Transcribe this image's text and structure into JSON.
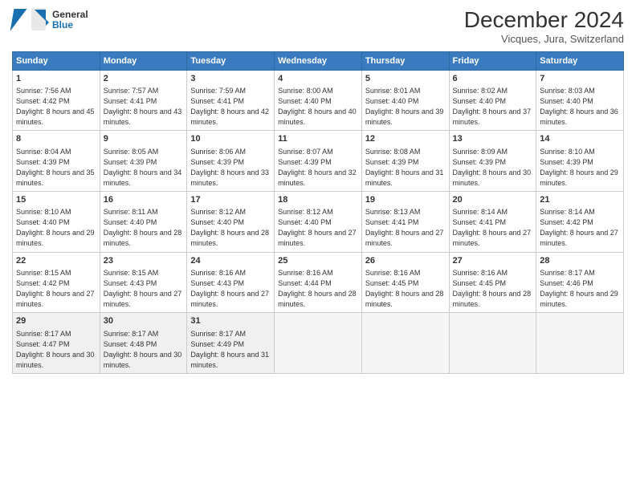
{
  "header": {
    "logo_line1": "General",
    "logo_line2": "Blue",
    "month_title": "December 2024",
    "location": "Vicques, Jura, Switzerland"
  },
  "days_of_week": [
    "Sunday",
    "Monday",
    "Tuesday",
    "Wednesday",
    "Thursday",
    "Friday",
    "Saturday"
  ],
  "weeks": [
    [
      {
        "day": "1",
        "sunrise": "7:56 AM",
        "sunset": "4:42 PM",
        "daylight": "8 hours and 45 minutes."
      },
      {
        "day": "2",
        "sunrise": "7:57 AM",
        "sunset": "4:41 PM",
        "daylight": "8 hours and 43 minutes."
      },
      {
        "day": "3",
        "sunrise": "7:59 AM",
        "sunset": "4:41 PM",
        "daylight": "8 hours and 42 minutes."
      },
      {
        "day": "4",
        "sunrise": "8:00 AM",
        "sunset": "4:40 PM",
        "daylight": "8 hours and 40 minutes."
      },
      {
        "day": "5",
        "sunrise": "8:01 AM",
        "sunset": "4:40 PM",
        "daylight": "8 hours and 39 minutes."
      },
      {
        "day": "6",
        "sunrise": "8:02 AM",
        "sunset": "4:40 PM",
        "daylight": "8 hours and 37 minutes."
      },
      {
        "day": "7",
        "sunrise": "8:03 AM",
        "sunset": "4:40 PM",
        "daylight": "8 hours and 36 minutes."
      }
    ],
    [
      {
        "day": "8",
        "sunrise": "8:04 AM",
        "sunset": "4:39 PM",
        "daylight": "8 hours and 35 minutes."
      },
      {
        "day": "9",
        "sunrise": "8:05 AM",
        "sunset": "4:39 PM",
        "daylight": "8 hours and 34 minutes."
      },
      {
        "day": "10",
        "sunrise": "8:06 AM",
        "sunset": "4:39 PM",
        "daylight": "8 hours and 33 minutes."
      },
      {
        "day": "11",
        "sunrise": "8:07 AM",
        "sunset": "4:39 PM",
        "daylight": "8 hours and 32 minutes."
      },
      {
        "day": "12",
        "sunrise": "8:08 AM",
        "sunset": "4:39 PM",
        "daylight": "8 hours and 31 minutes."
      },
      {
        "day": "13",
        "sunrise": "8:09 AM",
        "sunset": "4:39 PM",
        "daylight": "8 hours and 30 minutes."
      },
      {
        "day": "14",
        "sunrise": "8:10 AM",
        "sunset": "4:39 PM",
        "daylight": "8 hours and 29 minutes."
      }
    ],
    [
      {
        "day": "15",
        "sunrise": "8:10 AM",
        "sunset": "4:40 PM",
        "daylight": "8 hours and 29 minutes."
      },
      {
        "day": "16",
        "sunrise": "8:11 AM",
        "sunset": "4:40 PM",
        "daylight": "8 hours and 28 minutes."
      },
      {
        "day": "17",
        "sunrise": "8:12 AM",
        "sunset": "4:40 PM",
        "daylight": "8 hours and 28 minutes."
      },
      {
        "day": "18",
        "sunrise": "8:12 AM",
        "sunset": "4:40 PM",
        "daylight": "8 hours and 27 minutes."
      },
      {
        "day": "19",
        "sunrise": "8:13 AM",
        "sunset": "4:41 PM",
        "daylight": "8 hours and 27 minutes."
      },
      {
        "day": "20",
        "sunrise": "8:14 AM",
        "sunset": "4:41 PM",
        "daylight": "8 hours and 27 minutes."
      },
      {
        "day": "21",
        "sunrise": "8:14 AM",
        "sunset": "4:42 PM",
        "daylight": "8 hours and 27 minutes."
      }
    ],
    [
      {
        "day": "22",
        "sunrise": "8:15 AM",
        "sunset": "4:42 PM",
        "daylight": "8 hours and 27 minutes."
      },
      {
        "day": "23",
        "sunrise": "8:15 AM",
        "sunset": "4:43 PM",
        "daylight": "8 hours and 27 minutes."
      },
      {
        "day": "24",
        "sunrise": "8:16 AM",
        "sunset": "4:43 PM",
        "daylight": "8 hours and 27 minutes."
      },
      {
        "day": "25",
        "sunrise": "8:16 AM",
        "sunset": "4:44 PM",
        "daylight": "8 hours and 28 minutes."
      },
      {
        "day": "26",
        "sunrise": "8:16 AM",
        "sunset": "4:45 PM",
        "daylight": "8 hours and 28 minutes."
      },
      {
        "day": "27",
        "sunrise": "8:16 AM",
        "sunset": "4:45 PM",
        "daylight": "8 hours and 28 minutes."
      },
      {
        "day": "28",
        "sunrise": "8:17 AM",
        "sunset": "4:46 PM",
        "daylight": "8 hours and 29 minutes."
      }
    ],
    [
      {
        "day": "29",
        "sunrise": "8:17 AM",
        "sunset": "4:47 PM",
        "daylight": "8 hours and 30 minutes."
      },
      {
        "day": "30",
        "sunrise": "8:17 AM",
        "sunset": "4:48 PM",
        "daylight": "8 hours and 30 minutes."
      },
      {
        "day": "31",
        "sunrise": "8:17 AM",
        "sunset": "4:49 PM",
        "daylight": "8 hours and 31 minutes."
      },
      null,
      null,
      null,
      null
    ]
  ]
}
